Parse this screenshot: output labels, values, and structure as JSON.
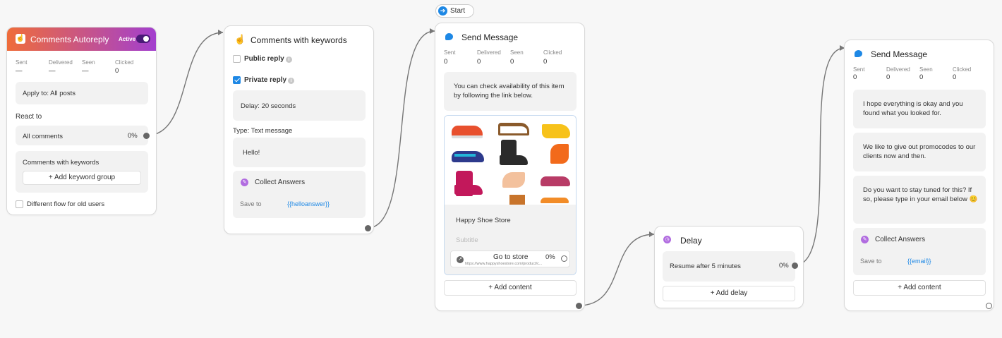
{
  "start": {
    "label": "Start"
  },
  "autoreply": {
    "title": "Comments Autoreply",
    "status": "Active",
    "stats": [
      {
        "label": "Sent",
        "value": "—"
      },
      {
        "label": "Delivered",
        "value": "—"
      },
      {
        "label": "Seen",
        "value": "—"
      },
      {
        "label": "Clicked",
        "value": "0"
      }
    ],
    "apply_to": "Apply to: All posts",
    "react_to": "React to",
    "all_comments": "All comments",
    "all_comments_pct": "0%",
    "keywords_label": "Comments with keywords",
    "add_keyword_group": "+ Add keyword group",
    "different_flow": "Different flow for old users"
  },
  "keywords": {
    "title": "Comments with keywords",
    "public_reply": "Public reply",
    "private_reply": "Private reply",
    "delay": "Delay: 20 seconds",
    "type": "Type: Text message",
    "message": "Hello!",
    "collect_title": "Collect Answers",
    "save_to": "Save to",
    "save_var": "{{helloanswer}}"
  },
  "send1": {
    "title": "Send Message",
    "stats": [
      {
        "label": "Sent",
        "value": "0"
      },
      {
        "label": "Delivered",
        "value": "0"
      },
      {
        "label": "Seen",
        "value": "0"
      },
      {
        "label": "Clicked",
        "value": "0"
      }
    ],
    "text": "You can check availability of this item by following the link below.",
    "card_title": "Happy Shoe Store",
    "card_subtitle": "Subtitle",
    "button_label": "Go to store",
    "button_pct": "0%",
    "button_url": "https://www.happyshoestore.com/product/c...",
    "add_content": "+ Add content"
  },
  "delay": {
    "title": "Delay",
    "resume": "Resume after 5 minutes",
    "pct": "0%",
    "add_delay": "+ Add delay"
  },
  "send2": {
    "title": "Send Message",
    "stats": [
      {
        "label": "Sent",
        "value": "0"
      },
      {
        "label": "Delivered",
        "value": "0"
      },
      {
        "label": "Seen",
        "value": "0"
      },
      {
        "label": "Clicked",
        "value": "0"
      }
    ],
    "msg1": "I hope everything is okay and you found what you looked for.",
    "msg2": "We like to give out promocodes to our clients now and then.",
    "msg3": "Do you want to stay tuned for this? If so, please type in your email below 😊",
    "collect_title": "Collect Answers",
    "save_to": "Save to",
    "save_var": "{{email}}",
    "add_content": "+ Add content"
  },
  "colors": {
    "header_gradient_start": "#ef6c3a",
    "header_gradient_end": "#a23fd0",
    "accent_blue": "#1e88e5",
    "collect_purple": "#b16ce0"
  }
}
